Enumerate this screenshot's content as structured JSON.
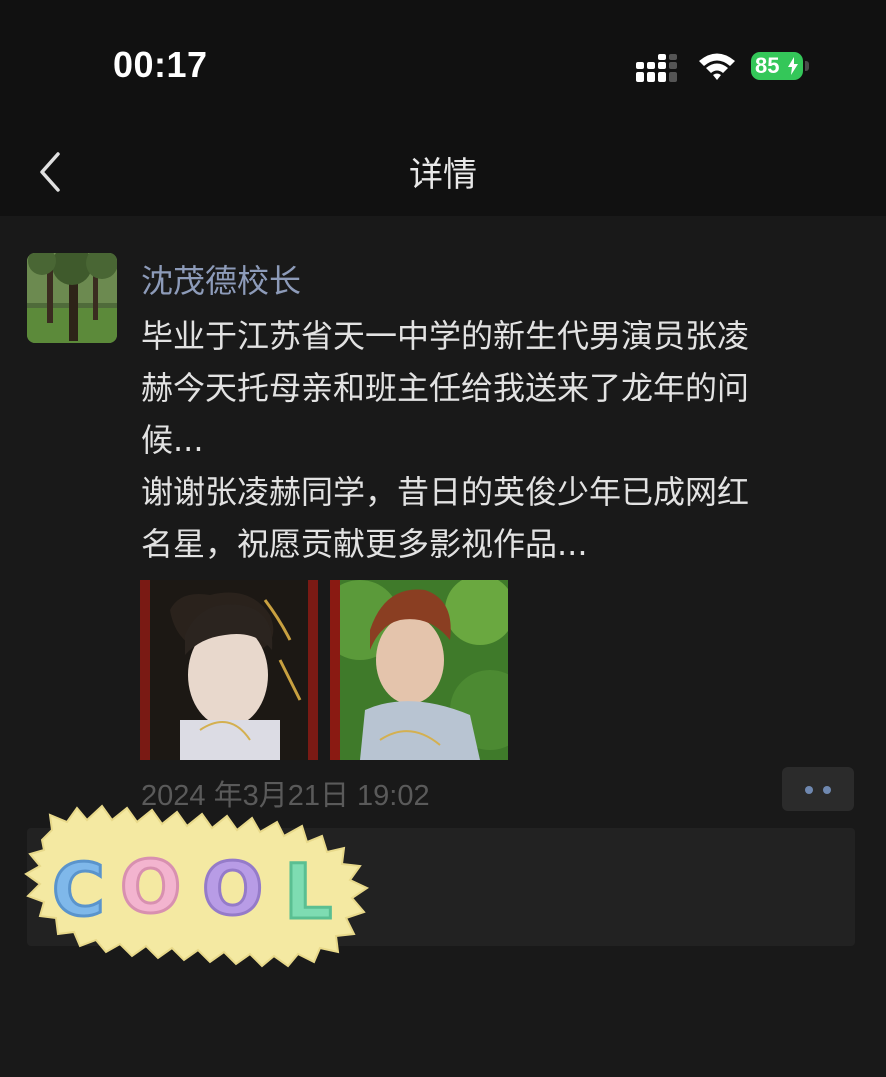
{
  "status_bar": {
    "time": "00:17",
    "battery": "85",
    "battery_color": "#34c759"
  },
  "nav": {
    "title": "详情",
    "back_icon": "chevron-left-icon"
  },
  "post": {
    "author": "沈茂德校长",
    "author_color": "#8d9bb9",
    "lines": [
      "毕业于江苏省天一中学的新生代男演员张凌",
      "赫今天托母亲和班主任给我送来了龙年的问",
      "候...",
      "谢谢张凌赫同学，昔日的英俊少年已成网红",
      "名星，祝愿贡献更多影视作品..."
    ],
    "timestamp": "2024 年3月21日 19:02",
    "more_icon": "more-dots-icon"
  },
  "sticker": {
    "text": "COOL"
  }
}
